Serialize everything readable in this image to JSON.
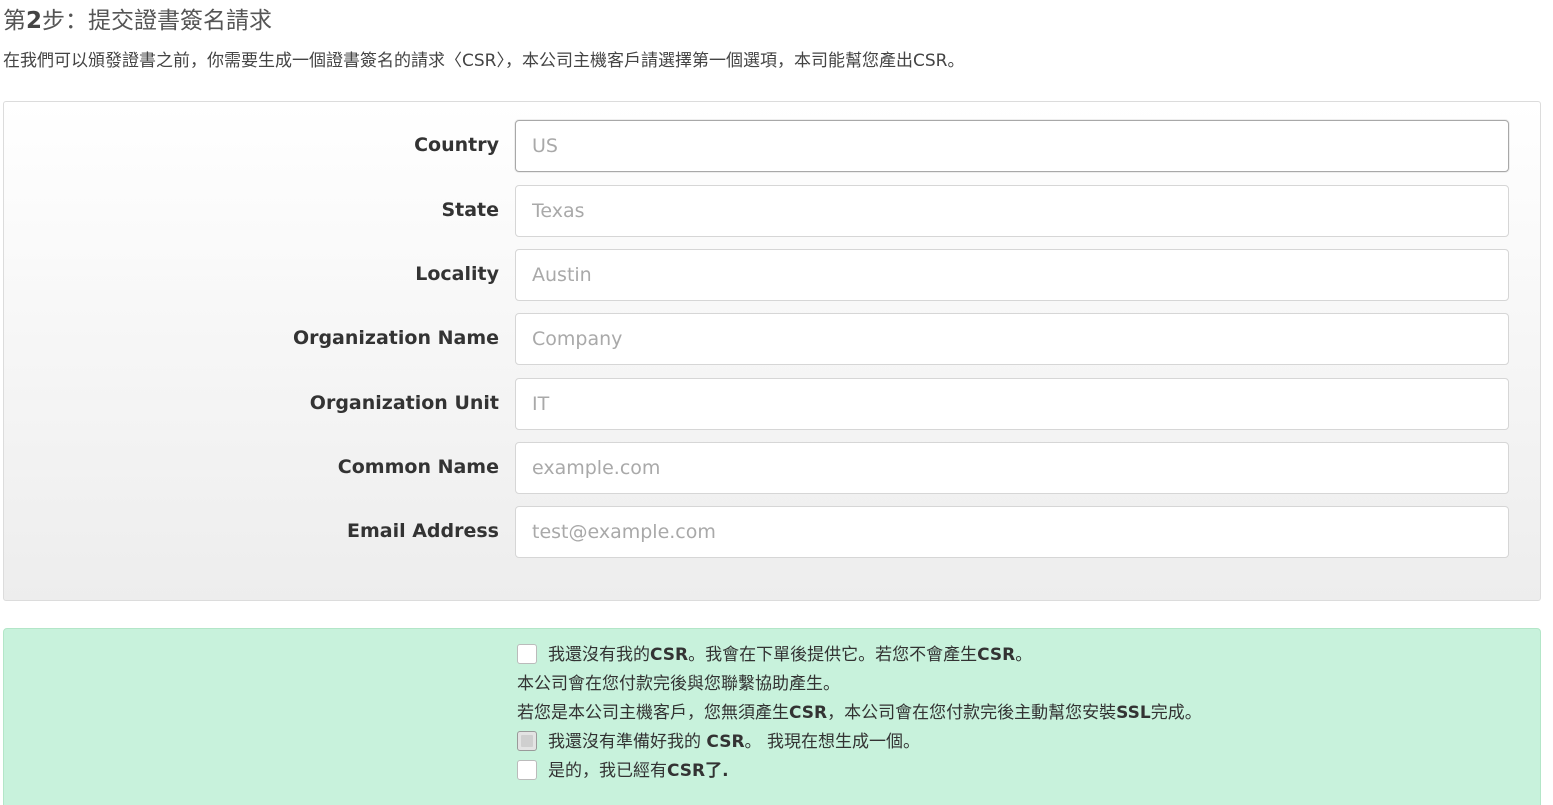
{
  "step": {
    "prefix": "第",
    "number": "2",
    "title_rest": "步：提交證書簽名請求",
    "description": "在我們可以頒發證書之前，你需要生成一個證書簽名的請求〈CSR〉，本公司主機客戶請選擇第一個選項，本司能幫您產出CSR。"
  },
  "form": {
    "fields": [
      {
        "label": "Country",
        "placeholder": "US",
        "value": ""
      },
      {
        "label": "State",
        "placeholder": "Texas",
        "value": ""
      },
      {
        "label": "Locality",
        "placeholder": "Austin",
        "value": ""
      },
      {
        "label": "Organization Name",
        "placeholder": "Company",
        "value": ""
      },
      {
        "label": "Organization Unit",
        "placeholder": "IT",
        "value": ""
      },
      {
        "label": "Common Name",
        "placeholder": "example.com",
        "value": ""
      },
      {
        "label": "Email Address",
        "placeholder": "test@example.com",
        "value": ""
      }
    ],
    "focused_field": "Country"
  },
  "csr_options": {
    "option1": {
      "t1": "我還沒有我的",
      "b1": "CSR",
      "t2": "。我會在下單後提供它。若您不會產生",
      "b2": "CSR",
      "t3": "。",
      "checked": false
    },
    "note1": "本公司會在您付款完後與您聯繫協助產生。",
    "note2": {
      "t1": "若您是本公司主機客戶，您無須產生",
      "b1": "CSR",
      "t2": "，本公司會在您付款完後主動幫您安裝",
      "b2": "SSL",
      "t3": "完成。"
    },
    "option2": {
      "t1": "我還沒有準備好我的 ",
      "b1": "CSR",
      "t2": "。 我現在想生成一個。",
      "checked": false
    },
    "option3": {
      "t1": "是的，我已經有",
      "b1": "CSR了.",
      "checked": false
    }
  },
  "colors": {
    "csr_panel_bg": "#c8f2dc",
    "form_panel_border": "#dcdcdc"
  }
}
